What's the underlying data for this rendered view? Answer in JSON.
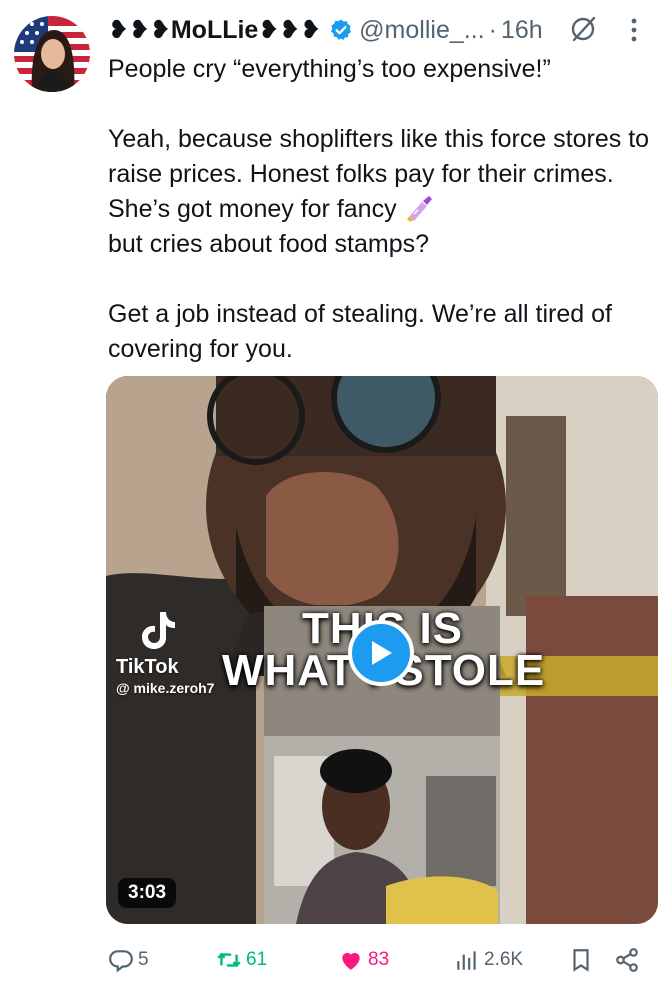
{
  "tweet": {
    "display_name": "❥❥❥MoLLie❥❥❥",
    "handle": "@mollie_...",
    "separator": "·",
    "time": "16h",
    "paragraphs": [
      "People cry “everything’s too expensive!”",
      "Yeah, because shoplifters like this force stores to raise prices. Honest folks pay for their crimes. She’s got money for fancy",
      "but cries about food stamps?",
      "Get a job instead of stealing. We’re all tired of covering for you."
    ],
    "emoji": "nail-polish-icon"
  },
  "media": {
    "watermark_brand": "TikTok",
    "watermark_user": "@ mike.zeroh7",
    "overlay_line1": "THIS IS",
    "overlay_line2": "WHAT I STOLE",
    "duration": "3:03"
  },
  "actions": {
    "replies": "5",
    "retweets": "61",
    "likes": "83",
    "views": "2.6K"
  },
  "colors": {
    "verified": "#1d9bf0",
    "retweeted": "#00ba7c",
    "liked": "#f91880",
    "muted": "#536471",
    "play": "#1d9bf0"
  }
}
